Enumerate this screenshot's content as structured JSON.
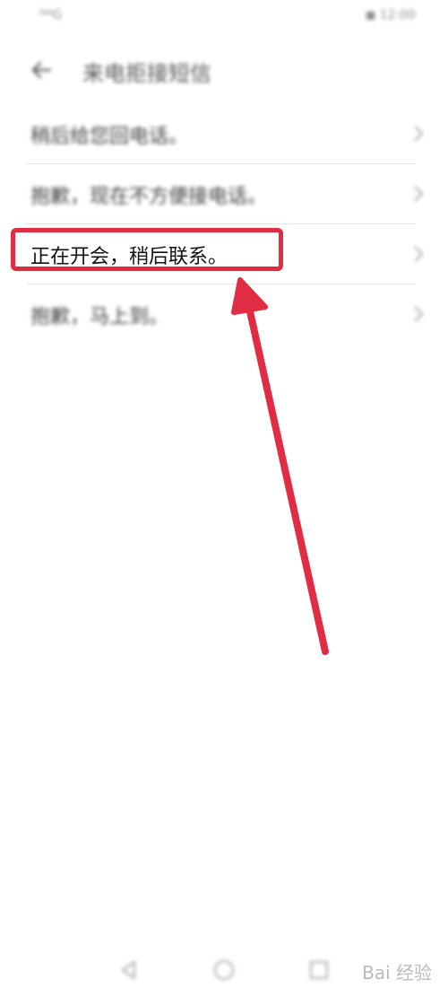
{
  "status_bar": {
    "left_text": "ˡᴺ⁴G",
    "right_text": "◼ 12:00"
  },
  "header": {
    "title": "来电拒接短信"
  },
  "replies": [
    {
      "label": "稍后给您回电话。"
    },
    {
      "label": "抱歉，现在不方便接电话。"
    },
    {
      "label": "正在开会，稍后联系。"
    },
    {
      "label": "抱歉，马上到。"
    }
  ],
  "watermark": {
    "text": "Bai 经验"
  },
  "colors": {
    "annotation": "#e02d44"
  }
}
